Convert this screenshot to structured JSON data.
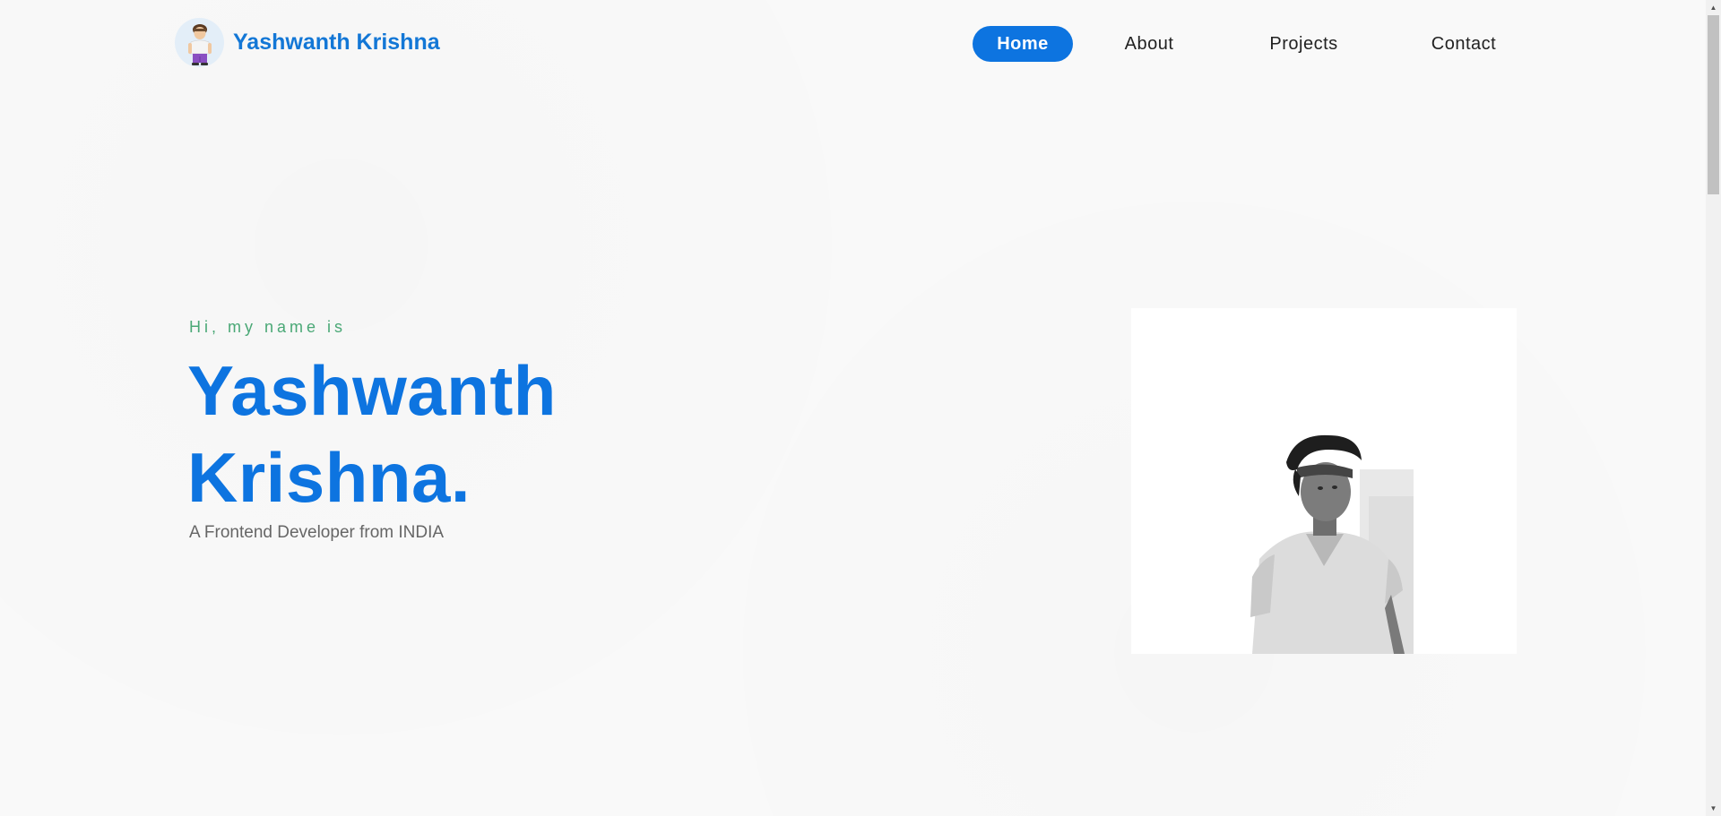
{
  "header": {
    "brand_name": "Yashwanth Krishna"
  },
  "nav": {
    "items": [
      {
        "label": "Home",
        "active": true
      },
      {
        "label": "About",
        "active": false
      },
      {
        "label": "Projects",
        "active": false
      },
      {
        "label": "Contact",
        "active": false
      }
    ]
  },
  "hero": {
    "greeting": "Hi, my name is",
    "name_line1": "Yashwanth",
    "name_line2": "Krishna.",
    "tagline": "A Frontend Developer from INDIA"
  },
  "icons": {
    "avatar": "cartoon-boy-avatar",
    "photo": "portrait-photo",
    "scroll_up": "triangle-up",
    "scroll_down": "triangle-down"
  },
  "colors": {
    "accent": "#0d74e0",
    "brand": "#1377d6",
    "greeting": "#4aa876",
    "tagline": "#666666",
    "background": "#f9f9f9"
  }
}
